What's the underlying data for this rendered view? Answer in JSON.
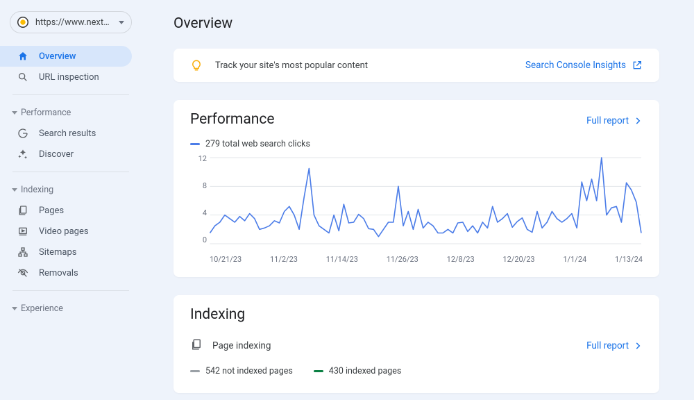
{
  "sidebar": {
    "property_url": "https://www.nextste…",
    "nav": {
      "overview": "Overview",
      "url_inspection": "URL inspection"
    },
    "groups": {
      "performance": {
        "header": "Performance",
        "items": {
          "search_results": "Search results",
          "discover": "Discover"
        }
      },
      "indexing": {
        "header": "Indexing",
        "items": {
          "pages": "Pages",
          "video_pages": "Video pages",
          "sitemaps": "Sitemaps",
          "removals": "Removals"
        }
      },
      "experience": {
        "header": "Experience"
      }
    }
  },
  "page": {
    "title": "Overview"
  },
  "insights_banner": {
    "text": "Track your site's most popular content",
    "link_label": "Search Console Insights"
  },
  "performance_card": {
    "title": "Performance",
    "full_report": "Full report",
    "legend": "279 total web search clicks",
    "legend_color": "#4c7de8"
  },
  "chart_data": {
    "type": "line",
    "title": "",
    "xlabel": "",
    "ylabel": "",
    "ylim": [
      0,
      12
    ],
    "y_ticks": [
      12,
      8,
      4,
      0
    ],
    "categories": [
      "10/21/23",
      "",
      "",
      "",
      "",
      "",
      "",
      "",
      "",
      "",
      "",
      "",
      "11/2/23",
      "",
      "",
      "",
      "",
      "",
      "",
      "",
      "",
      "",
      "",
      "",
      "11/14/23",
      "",
      "",
      "",
      "",
      "",
      "",
      "",
      "",
      "",
      "",
      "",
      "11/26/23",
      "",
      "",
      "",
      "",
      "",
      "",
      "",
      "",
      "",
      "",
      "",
      "12/8/23",
      "",
      "",
      "",
      "",
      "",
      "",
      "",
      "",
      "",
      "",
      "",
      "12/20/23",
      "",
      "",
      "",
      "",
      "",
      "",
      "",
      "",
      "",
      "",
      "",
      "1/1/24",
      "",
      "",
      "",
      "",
      "",
      "",
      "",
      "",
      "",
      "",
      "",
      "1/13/24",
      "",
      "",
      ""
    ],
    "x_tick_labels": [
      "10/21/23",
      "11/2/23",
      "11/14/23",
      "11/26/23",
      "12/8/23",
      "12/20/23",
      "1/1/24",
      "1/13/24"
    ],
    "series": [
      {
        "name": "web search clicks",
        "color": "#4c7de8",
        "values": [
          1.5,
          2.5,
          3,
          4,
          3.5,
          3,
          3.8,
          3.2,
          4.2,
          3.5,
          2,
          2.2,
          2.5,
          3.2,
          2.9,
          4.5,
          5.2,
          4,
          2,
          6.5,
          10.5,
          4,
          2.5,
          2,
          1.5,
          4,
          1.8,
          5.5,
          2.9,
          3,
          4.1,
          3.5,
          2.1,
          2,
          1,
          2,
          3,
          3,
          8,
          2.5,
          4.5,
          2,
          4.8,
          2.2,
          3,
          2.5,
          1.5,
          1.5,
          2,
          1.5,
          2.9,
          3,
          1.7,
          2.5,
          1.5,
          3,
          2.2,
          5.2,
          3,
          3.5,
          4.2,
          2.3,
          3.1,
          3.6,
          2,
          1.6,
          4.5,
          2.2,
          3,
          4.5,
          3.5,
          3,
          3.5,
          4.2,
          2.2,
          8.6,
          6,
          9,
          6,
          12,
          4,
          5,
          5.2,
          3,
          8.5,
          7.5,
          5.8,
          1.5
        ]
      }
    ]
  },
  "indexing_card": {
    "title": "Indexing",
    "row_label": "Page indexing",
    "full_report": "Full report",
    "not_indexed": "542 not indexed pages",
    "indexed": "430 indexed pages",
    "not_indexed_color": "#9aa0a6",
    "indexed_color": "#0b8043"
  }
}
